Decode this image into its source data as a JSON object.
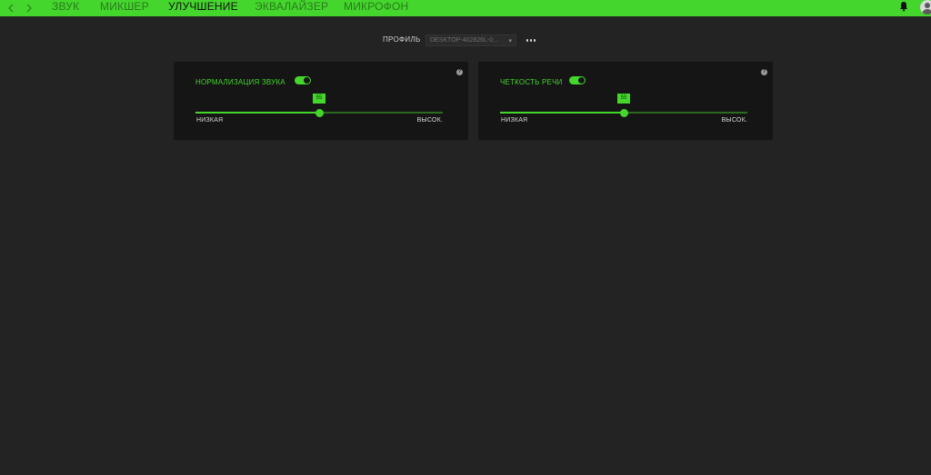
{
  "header": {
    "tabs": [
      {
        "label": "ЗВУК",
        "active": false
      },
      {
        "label": "МИКШЕР",
        "active": false
      },
      {
        "label": "УЛУЧШЕНИЕ",
        "active": true
      },
      {
        "label": "ЭКВАЛАЙЗЕР",
        "active": false
      },
      {
        "label": "МИКРОФОН",
        "active": false
      }
    ],
    "icons": {
      "back": "chevron-left-icon",
      "forward": "chevron-right-icon",
      "notifications": "bell-icon",
      "user": "user-avatar-icon"
    }
  },
  "profile": {
    "label": "ПРОФИЛЬ",
    "selected": "DESKTOP-402826L-0...",
    "caret": "▾"
  },
  "cards": [
    {
      "title": "НОРМАЛИЗАЦИЯ ЗВУКА",
      "enabled": true,
      "slider": {
        "value": "55",
        "level": 0.5,
        "low_label": "НИЗКАЯ",
        "high_label": "ВЫСОК."
      },
      "help": "?"
    },
    {
      "title": "ЧЕТКОСТЬ РЕЧИ",
      "enabled": true,
      "slider": {
        "value": "55",
        "level": 0.5,
        "low_label": "НИЗКАЯ",
        "high_label": "ВЫСОК."
      },
      "help": "?"
    }
  ],
  "colors": {
    "accent": "#44d62c",
    "background": "#232323",
    "card": "#151515"
  }
}
